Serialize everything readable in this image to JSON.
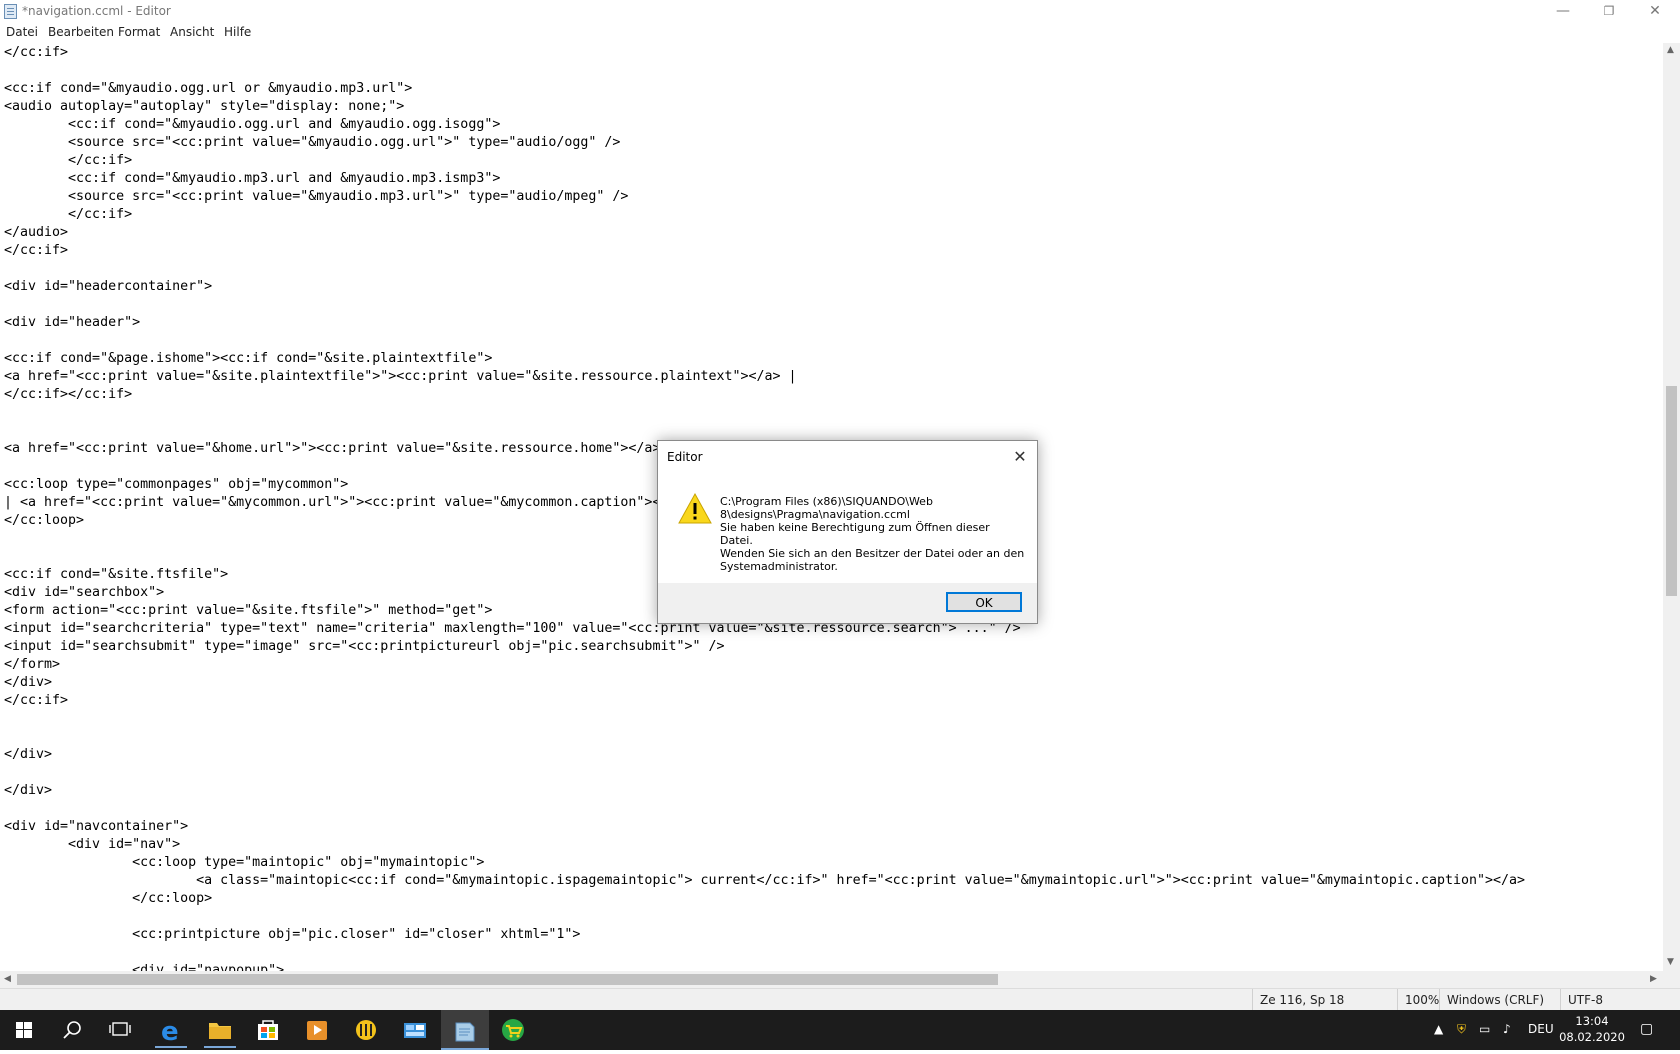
{
  "window": {
    "title": "*navigation.ccml - Editor",
    "minimize_glyph": "—",
    "maximize_glyph": "❐",
    "close_glyph": "✕"
  },
  "menu": [
    "Datei",
    "Bearbeiten",
    "Format",
    "Ansicht",
    "Hilfe"
  ],
  "editor": {
    "lines": [
      "</cc:if>",
      "",
      "<cc:if cond=\"&myaudio.ogg.url or &myaudio.mp3.url\">",
      "<audio autoplay=\"autoplay\" style=\"display: none;\">",
      "        <cc:if cond=\"&myaudio.ogg.url and &myaudio.ogg.isogg\">",
      "        <source src=\"<cc:print value=\"&myaudio.ogg.url\">\" type=\"audio/ogg\" />",
      "        </cc:if>",
      "        <cc:if cond=\"&myaudio.mp3.url and &myaudio.mp3.ismp3\">",
      "        <source src=\"<cc:print value=\"&myaudio.mp3.url\">\" type=\"audio/mpeg\" />",
      "        </cc:if>",
      "</audio>",
      "</cc:if>",
      "",
      "<div id=\"headercontainer\">",
      "",
      "<div id=\"header\">",
      "",
      "<cc:if cond=\"&page.ishome\"><cc:if cond=\"&site.plaintextfile\">",
      "<a href=\"<cc:print value=\"&site.plaintextfile\">\"><cc:print value=\"&site.ressource.plaintext\"></a> |",
      "</cc:if></cc:if>",
      "",
      "",
      "<a href=\"<cc:print value=\"&home.url\">\"><cc:print value=\"&site.ressource.home\"></a>",
      "",
      "<cc:loop type=\"commonpages\" obj=\"mycommon\">",
      "| <a href=\"<cc:print value=\"&mycommon.url\">\"><cc:print value=\"&mycommon.caption\"><",
      "</cc:loop>",
      "",
      "",
      "<cc:if cond=\"&site.ftsfile\">",
      "<div id=\"searchbox\">",
      "<form action=\"<cc:print value=\"&site.ftsfile\">\" method=\"get\">",
      "<input id=\"searchcriteria\" type=\"text\" name=\"criteria\" maxlength=\"100\" value=\"<cc:print value=\"&site.ressource.search\"> ...\" />",
      "<input id=\"searchsubmit\" type=\"image\" src=\"<cc:printpictureurl obj=\"pic.searchsubmit\">\" />",
      "</form>",
      "</div>",
      "</cc:if>",
      "",
      "",
      "</div>",
      "",
      "</div>",
      "",
      "<div id=\"navcontainer\">",
      "        <div id=\"nav\">",
      "                <cc:loop type=\"maintopic\" obj=\"mymaintopic\">",
      "                        <a class=\"maintopic<cc:if cond=\"&mymaintopic.ispagemaintopic\"> current</cc:if>\" href=\"<cc:print value=\"&mymaintopic.url\">\"><cc:print value=\"&mymaintopic.caption\"></a>",
      "                </cc:loop>",
      "",
      "                <cc:printpicture obj=\"pic.closer\" id=\"closer\" xhtml=\"1\">",
      "",
      "                <div id=\"navpopup\">"
    ]
  },
  "status": {
    "position": "Ze 116, Sp 18",
    "zoom": "100%",
    "line_ending": "Windows (CRLF)",
    "encoding": "UTF-8"
  },
  "dialog": {
    "title": "Editor",
    "close_glyph": "✕",
    "message_lines": [
      "C:\\Program Files (x86)\\SIQUANDO\\Web",
      "8\\designs\\Pragma\\navigation.ccml",
      "Sie haben keine Berechtigung zum Öffnen dieser Datei.",
      "Wenden Sie sich an den Besitzer der Datei oder an den",
      "Systemadministrator."
    ],
    "ok_label": "OK",
    "icon": "warning-icon"
  },
  "taskbar": {
    "apps": [
      "start-icon",
      "search-icon",
      "task-view-icon",
      "edge-icon",
      "file-explorer-icon",
      "store-icon",
      "media-player-icon",
      "norton-icon",
      "control-panel-icon",
      "notepad-icon",
      "shop-icon"
    ],
    "language": "DEU",
    "time": "13:04",
    "date": "08.02.2020"
  }
}
